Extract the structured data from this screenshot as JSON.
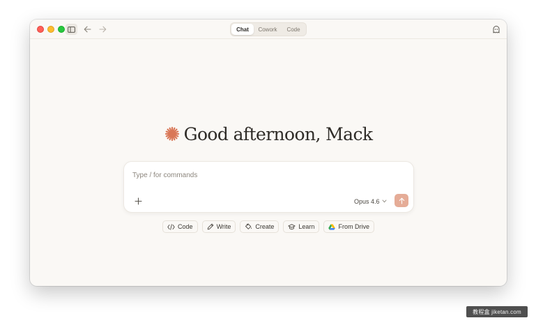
{
  "mode_switch": {
    "tabs": [
      {
        "label": "Chat",
        "active": true
      },
      {
        "label": "Cowork",
        "active": false
      },
      {
        "label": "Code",
        "active": false
      }
    ]
  },
  "greeting": {
    "text": "Good afternoon, Mack"
  },
  "composer": {
    "placeholder": "Type / for commands",
    "value": "",
    "model_label": "Opus 4.6"
  },
  "chips": [
    {
      "label": "Code",
      "icon": "code-icon"
    },
    {
      "label": "Write",
      "icon": "pencil-icon"
    },
    {
      "label": "Create",
      "icon": "paint-bucket-icon"
    },
    {
      "label": "Learn",
      "icon": "graduation-cap-icon"
    },
    {
      "label": "From Drive",
      "icon": "google-drive-icon"
    }
  ],
  "watermark": {
    "text": "教程盒 jiketan.com"
  },
  "colors": {
    "window_bg": "#faf8f5",
    "accent": "#d97757",
    "send_button": "#e5ac97",
    "traffic_red": "#ff5f57",
    "traffic_yellow": "#febc2e",
    "traffic_green": "#28c840"
  }
}
